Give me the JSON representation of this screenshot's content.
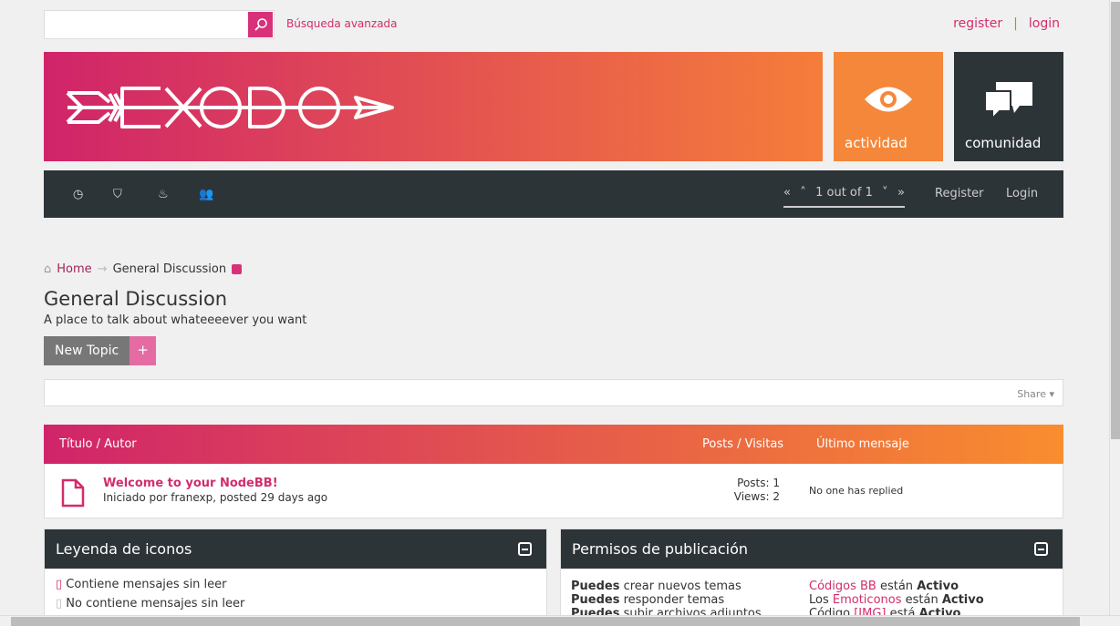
{
  "header": {
    "search_placeholder": "",
    "search_value": "",
    "advanced_search": "Búsqueda avanzada",
    "register": "register",
    "separator": "|",
    "login": "login"
  },
  "banner": {
    "logo_text": "EXODO"
  },
  "tiles": [
    {
      "label": "actividad",
      "icon": "eye-icon",
      "color": "#f5873a"
    },
    {
      "label": "comunidad",
      "icon": "comments-icon",
      "color": "#2d3438"
    }
  ],
  "navbar": {
    "icons": [
      "clock-icon",
      "tags-icon",
      "fire-icon",
      "users-icon"
    ],
    "pager": "1 out of 1",
    "register": "Register",
    "login": "Login"
  },
  "breadcrumb": {
    "home": "Home",
    "arrow": "→",
    "current": "General Discussion"
  },
  "category": {
    "title": "General Discussion",
    "description": "A place to talk about whateeeever you want",
    "new_topic": "New Topic",
    "plus": "+",
    "share": "Share"
  },
  "table": {
    "col_title": "Título / Autor",
    "col_posts": "Posts / Visitas",
    "col_last": "Último mensaje",
    "rows": [
      {
        "title": "Welcome to your NodeBB!",
        "meta": "Iniciado por franexp, posted 29 days ago",
        "posts": "Posts: 1",
        "views": "Views: 2",
        "last": "No one has replied"
      }
    ]
  },
  "legend": {
    "title": "Leyenda de iconos",
    "items": [
      "Contiene mensajes sin leer",
      "No contiene mensajes sin leer"
    ]
  },
  "permissions": {
    "title": "Permisos de publicación",
    "left": [
      {
        "b": "Puedes",
        "t": " crear nuevos temas"
      },
      {
        "b": "Puedes",
        "t": " responder temas"
      },
      {
        "b": "Puedes",
        "t": " subir archivos adjuntos"
      }
    ],
    "right": [
      {
        "pre": "",
        "link": "Códigos BB",
        "mid": " están ",
        "b": "Activo"
      },
      {
        "pre": "Los ",
        "link": "Emoticonos",
        "mid": " están ",
        "b": "Activo"
      },
      {
        "pre": "Código ",
        "link": "[IMG]",
        "mid": " está ",
        "b": "Activo"
      }
    ]
  },
  "colors": {
    "accent": "#d12d6b",
    "dark": "#2d3438",
    "orange": "#f5873a"
  }
}
